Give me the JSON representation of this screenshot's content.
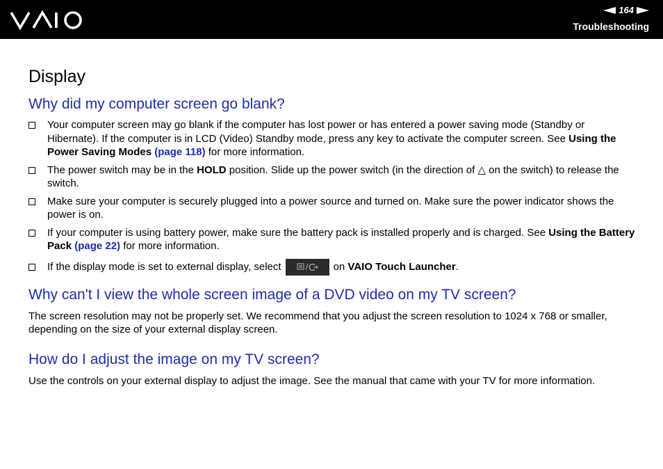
{
  "header": {
    "page_number": "164",
    "section": "Troubleshooting"
  },
  "title": "Display",
  "q1": {
    "heading": "Why did my computer screen go blank?",
    "b1": {
      "t1": "Your computer screen may go blank if the computer has lost power or has entered a power saving mode (Standby or Hibernate). If the computer is in LCD (Video) Standby mode, press any key to activate the computer screen. See ",
      "bold": "Using the Power Saving Modes",
      "link": "(page 118)",
      "t2": " for more information."
    },
    "b2": {
      "t1": "The power switch may be in the ",
      "bold": "HOLD",
      "t2": " position. Slide up the power switch (in the direction of △ on the switch) to release the switch."
    },
    "b3": {
      "t1": "Make sure your computer is securely plugged into a power source and turned on. Make sure the power indicator shows the power is on."
    },
    "b4": {
      "t1": "If your computer is using battery power, make sure the battery pack is installed properly and is charged. See ",
      "bold": "Using the Battery Pack",
      "link": "(page 22)",
      "t2": " for more information."
    },
    "b5": {
      "t1": "If the display mode is set to external display, select",
      "t2": "on ",
      "bold": "VAIO Touch Launcher",
      "t3": "."
    }
  },
  "q2": {
    "heading": "Why can't I view the whole screen image of a DVD video on my TV screen?",
    "text": "The screen resolution may not be properly set. We recommend that you adjust the screen resolution to 1024 x 768 or smaller, depending on the size of your external display screen."
  },
  "q3": {
    "heading": "How do I adjust the image on my TV screen?",
    "text": "Use the controls on your external display to adjust the image. See the manual that came with your TV for more information."
  },
  "icons": {
    "logo": "vaio-logo",
    "prev": "arrow-left-icon",
    "next": "arrow-right-icon",
    "bullet": "checkbox-bullet-icon",
    "display_button": "display-switch-icon"
  }
}
